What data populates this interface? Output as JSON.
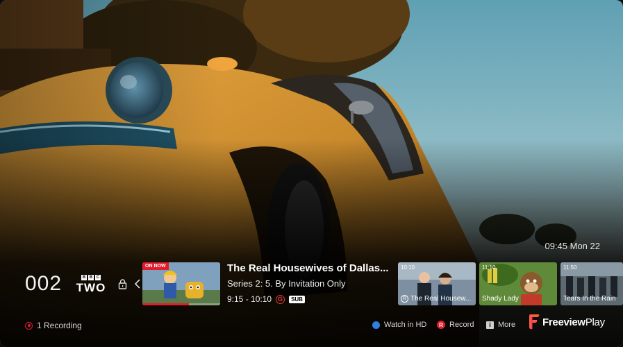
{
  "clock": "09:45 Mon 22",
  "channel": {
    "number": "002",
    "logo_blocks": [
      "B",
      "B",
      "C"
    ],
    "logo_name": "TWO"
  },
  "now": {
    "badge": "ON NOW",
    "title": "The Real Housewives of Dallas...",
    "episode": "Series 2: 5. By Invitation Only",
    "time": "9:15 - 10:10",
    "rating": "G",
    "subtitles": "SUB",
    "progress_fraction": 0.6
  },
  "next": [
    {
      "time": "10:10",
      "title": "The Real Housew...",
      "r_icon": "R"
    },
    {
      "time": "11:10",
      "title": "Shady Lady"
    },
    {
      "time": "11:50",
      "title": "Tears In the Rain"
    }
  ],
  "footer": {
    "recording": "1 Recording",
    "watch_hd": "Watch in HD",
    "record_icon": "R",
    "record": "Record",
    "more_icon": "i",
    "more": "More",
    "brand_freeview": "Freeview",
    "brand_play": "Play"
  },
  "colors": {
    "accent_red": "#e21b2d",
    "blue_button": "#2f7fe0"
  }
}
